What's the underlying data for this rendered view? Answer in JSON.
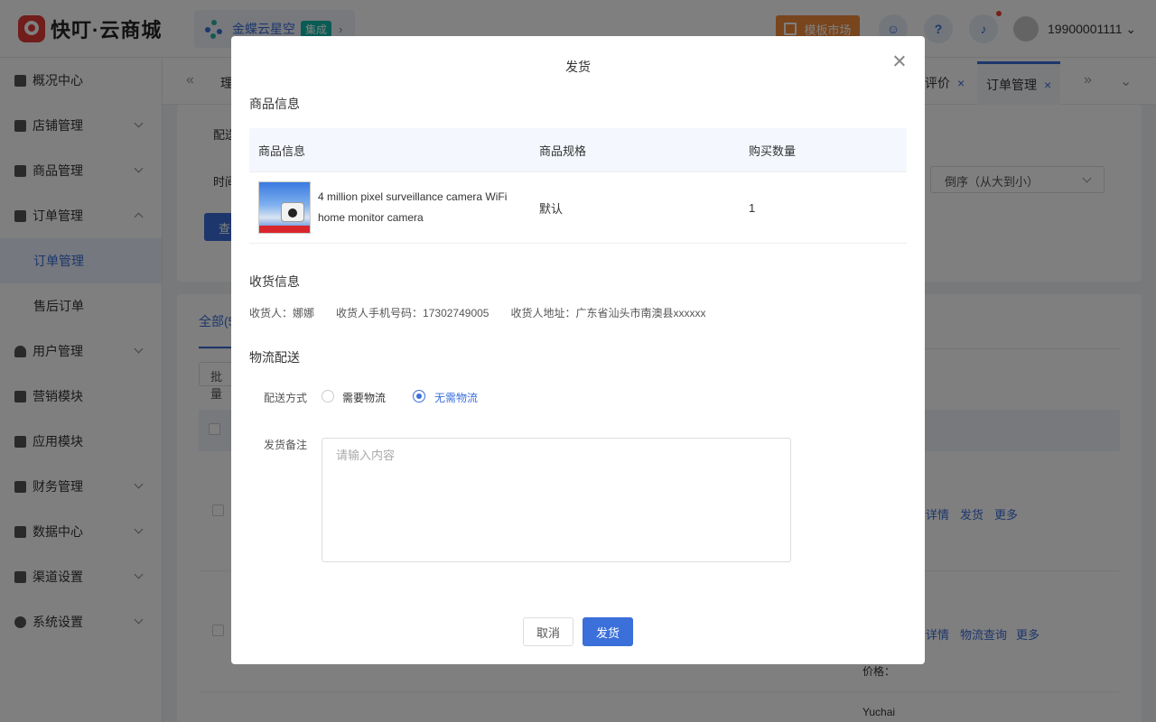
{
  "header": {
    "logo_text": "快叮·云商城",
    "kingdee_name": "金蝶云星空",
    "kingdee_badge": "集成",
    "template_market": "模板市场",
    "user_phone": "19900001111"
  },
  "sidebar": {
    "items": [
      {
        "label": "概况中心"
      },
      {
        "label": "店铺管理"
      },
      {
        "label": "商品管理"
      },
      {
        "label": "订单管理"
      },
      {
        "label": "订单管理"
      },
      {
        "label": "售后订单"
      },
      {
        "label": "用户管理"
      },
      {
        "label": "营销模块"
      },
      {
        "label": "应用模块"
      },
      {
        "label": "财务管理"
      },
      {
        "label": "数据中心"
      },
      {
        "label": "渠道设置"
      },
      {
        "label": "系统设置"
      }
    ]
  },
  "tabs": {
    "partial_left": "理",
    "review": "评价",
    "order_mgmt": "订单管理"
  },
  "background": {
    "label_delivery": "配送",
    "label_time": "时间",
    "sort_select": "倒序（从大到小）",
    "query_btn": "查",
    "tab_all": "全部(5",
    "batch_btn": "批量",
    "row1_links": [
      "详情",
      "发货",
      "更多"
    ],
    "row2_links": [
      "详情",
      "物流查询",
      "更多"
    ],
    "price_label": "价格：",
    "yuchai": "Yuchai"
  },
  "modal": {
    "title": "发货",
    "goods_section": "商品信息",
    "table_headers": [
      "商品信息",
      "商品规格",
      "购买数量"
    ],
    "product": {
      "name": "4 million pixel surveillance camera WiFi home monitor camera",
      "spec": "默认",
      "qty": "1"
    },
    "recv_section": "收货信息",
    "receiver_label": "收货人：",
    "receiver": "娜娜",
    "phone_label": "收货人手机号码：",
    "phone": "17302749005",
    "address_label": "收货人地址：",
    "address": "广东省汕头市南澳县xxxxxx",
    "logistics_section": "物流配送",
    "delivery_method_label": "配送方式",
    "opt_need": "需要物流",
    "opt_no_need": "无需物流",
    "remark_label": "发货备注",
    "remark_placeholder": "请输入内容",
    "cancel": "取消",
    "confirm": "发货"
  }
}
